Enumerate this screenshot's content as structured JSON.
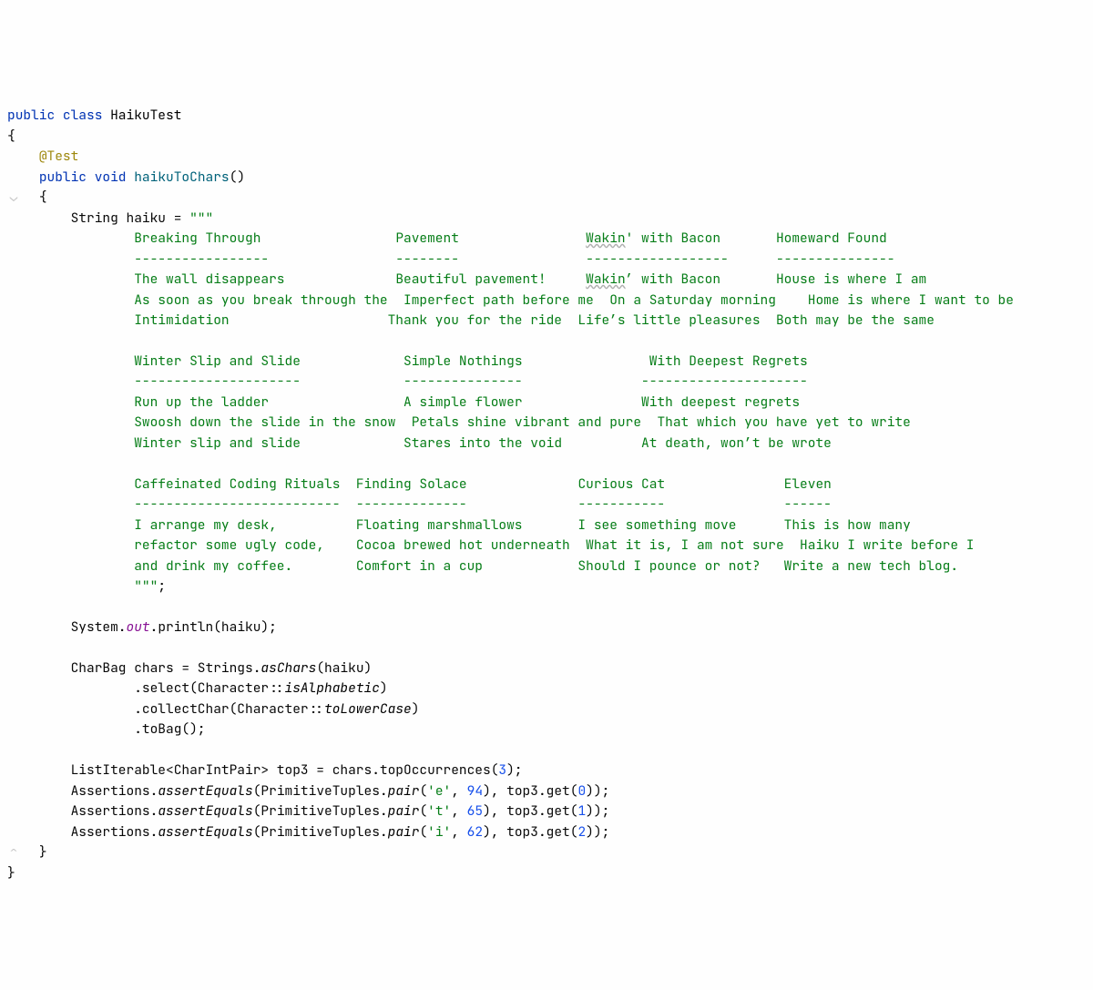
{
  "code": {
    "class_kw": "public class",
    "class_name": "HaikuTest",
    "open_brace": "{",
    "annotation": "@Test",
    "method_kw": "public void",
    "method_name": "haikuToChars",
    "method_parens": "()",
    "open_brace2": "{",
    "decl_haiku": "String haiku = ",
    "triple_open": "\"\"\"",
    "triple_close": "\"\"\"",
    "semicolon": ";",
    "haiku_lines": {
      "row1": {
        "c1": "Breaking Through",
        "sp1": "                 ",
        "c2": "Pavement",
        "sp2": "                ",
        "c3a": "Wakin",
        "c3b": "' with Bacon",
        "sp3": "       ",
        "c4": "Homeward Found"
      },
      "dash1": {
        "c1": "-----------------",
        "sp1": "                ",
        "c2": "--------",
        "sp2": "                ",
        "c3": "------------------",
        "sp3": "      ",
        "c4": "---------------"
      },
      "stanza1_l1": {
        "c1": "The wall disappears",
        "sp1": "              ",
        "c2": "Beautiful pavement!",
        "sp2": "     ",
        "c3a": "Wakin",
        "c3b": "’ with Bacon",
        "sp3": "       ",
        "c4": "House is where I am"
      },
      "stanza1_l2": {
        "c1": "As soon as you break through the",
        "sp1": "  ",
        "c2": "Imperfect path before me",
        "sp2": "  ",
        "c3": "On a Saturday morning",
        "sp3": "    ",
        "c4": "Home is where I want to be"
      },
      "stanza1_l3": {
        "c1": "Intimidation",
        "sp1": "                    ",
        "c2": "Thank you for the ride",
        "sp2": "  ",
        "c3": "Life’s little pleasures",
        "sp3": "  ",
        "c4": "Both may be the same"
      },
      "row2": {
        "c1": "Winter Slip and Slide",
        "sp1": "             ",
        "c2": "Simple Nothings",
        "sp2": "                ",
        "c3": "With Deepest Regrets"
      },
      "dash2": {
        "c1": "---------------------",
        "sp1": "             ",
        "c2": "---------------",
        "sp2": "               ",
        "c3": "---------------------"
      },
      "stanza2_l1": {
        "c1": "Run up the ladder",
        "sp1": "                 ",
        "c2": "A simple flower",
        "sp2": "               ",
        "c3": "With deepest regrets"
      },
      "stanza2_l2": {
        "c1": "Swoosh down the slide in the snow",
        "sp1": "  ",
        "c2": "Petals shine vibrant and pure",
        "sp2": "  ",
        "c3": "That which you have yet to write"
      },
      "stanza2_l3": {
        "c1": "Winter slip and slide",
        "sp1": "             ",
        "c2": "Stares into the void",
        "sp2": "          ",
        "c3": "At death, won’t be wrote"
      },
      "row3": {
        "c1": "Caffeinated Coding Rituals",
        "sp1": "  ",
        "c2": "Finding Solace",
        "sp2": "              ",
        "c3": "Curious Cat",
        "sp3": "               ",
        "c4": "Eleven"
      },
      "dash3": {
        "c1": "--------------------------",
        "sp1": "  ",
        "c2": "--------------",
        "sp2": "              ",
        "c3": "-----------",
        "sp3": "               ",
        "c4": "------"
      },
      "stanza3_l1": {
        "c1": "I arrange my desk,",
        "sp1": "          ",
        "c2": "Floating marshmallows",
        "sp2": "       ",
        "c3": "I see something move",
        "sp3": "      ",
        "c4": "This is how many"
      },
      "stanza3_l2": {
        "c1": "refactor some ugly code,",
        "sp1": "    ",
        "c2": "Cocoa brewed hot underneath",
        "sp2": "  ",
        "c3": "What it is, I am not sure",
        "sp3": "  ",
        "c4": "Haiku I write before I"
      },
      "stanza3_l3": {
        "c1": "and drink my coffee.",
        "sp1": "        ",
        "c2": "Comfort in a cup",
        "sp2": "            ",
        "c3": "Should I pounce or not?",
        "sp3": "   ",
        "c4": "Write a new tech blog."
      }
    },
    "println_pre": "System.",
    "println_out": "out",
    "println_post": ".println(haiku);",
    "charbag_decl": "CharBag chars = Strings.",
    "asChars": "asChars",
    "asChars_arg": "(haiku)",
    "select_line": ".select(Character::",
    "isAlphabetic": "isAlphabetic",
    "select_close": ")",
    "collect_line": ".collectChar(Character::",
    "toLowerCase": "toLowerCase",
    "collect_close": ")",
    "tobag_line": ".toBag();",
    "top3_decl": "ListIterable<CharIntPair> top3 = chars.topOccurrences(",
    "top3_arg": "3",
    "top3_close": ");",
    "assert_pre": "Assertions.",
    "assertEquals": "assertEquals",
    "primtuples": "(PrimitiveTuples.",
    "pair": "pair",
    "assert1": {
      "char": "'e'",
      "num": "94",
      "idx": "0"
    },
    "assert2": {
      "char": "'t'",
      "num": "65",
      "idx": "1"
    },
    "assert3": {
      "char": "'i'",
      "num": "62",
      "idx": "2"
    },
    "pair_close": "), top3.get(",
    "get_close": "));",
    "close_brace": "}",
    "close_brace2": "}"
  },
  "gutter": {
    "collapse1": "⌄",
    "collapse2": "⌃"
  }
}
